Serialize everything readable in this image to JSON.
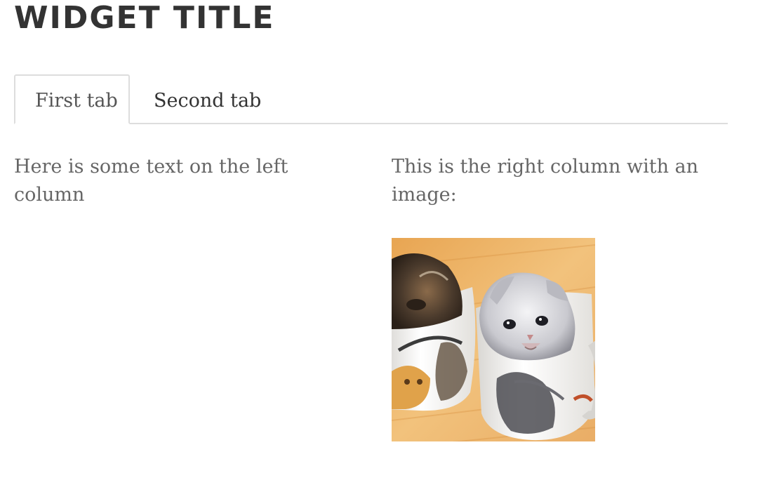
{
  "widget": {
    "title": "WIDGET TITLE"
  },
  "tabs": [
    {
      "label": "First tab",
      "active": true
    },
    {
      "label": "Second tab",
      "active": false
    }
  ],
  "content": {
    "left_text": "Here is some text on the left column",
    "right_text": "This is the right column with an image:",
    "image_subject": "kittens-in-mugs"
  },
  "colors": {
    "title": "#333333",
    "body_text": "#666666",
    "tab_border": "#dddddd"
  }
}
